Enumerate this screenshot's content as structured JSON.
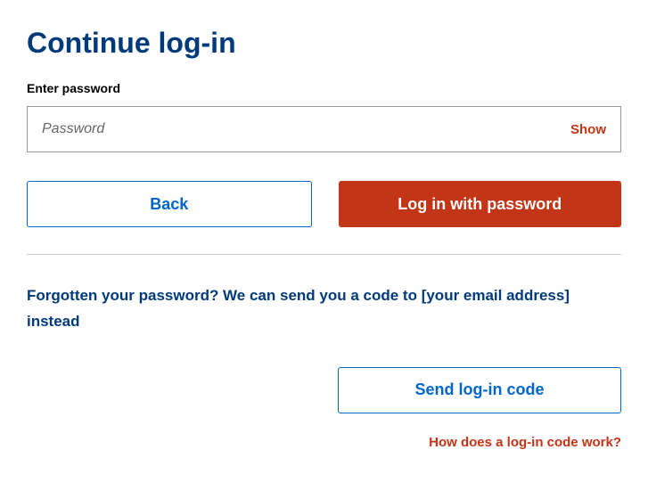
{
  "title": "Continue log-in",
  "password": {
    "label": "Enter password",
    "placeholder": "Password",
    "show_toggle": "Show"
  },
  "buttons": {
    "back": "Back",
    "login": "Log in with password",
    "send_code": "Send log-in code"
  },
  "forgotten_text": "Forgotten your password? We can send you a code to [your email address] instead",
  "help_link": "How does a log-in code work?"
}
